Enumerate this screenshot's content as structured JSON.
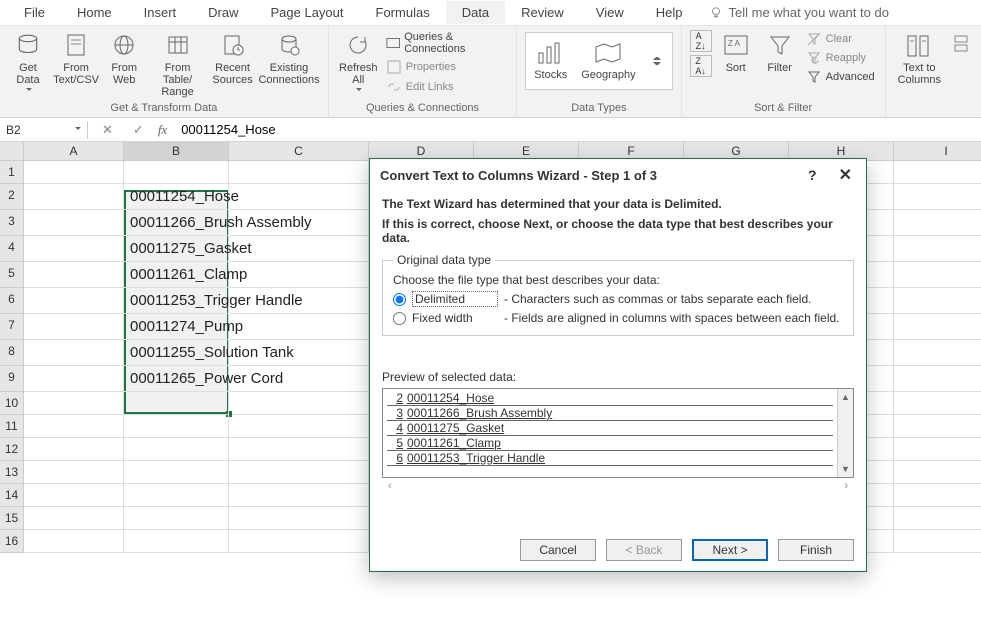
{
  "tabs": [
    "File",
    "Home",
    "Insert",
    "Draw",
    "Page Layout",
    "Formulas",
    "Data",
    "Review",
    "View",
    "Help"
  ],
  "active_tab": "Data",
  "tell_me": "Tell me what you want to do",
  "ribbon": {
    "groups": {
      "get_transform": {
        "label": "Get & Transform Data",
        "get_data": "Get\nData",
        "from_textcsv": "From\nText/CSV",
        "from_web": "From\nWeb",
        "from_table": "From Table/\nRange",
        "recent": "Recent\nSources",
        "existing": "Existing\nConnections"
      },
      "queries": {
        "label": "Queries & Connections",
        "refresh": "Refresh\nAll",
        "qc": "Queries & Connections",
        "props": "Properties",
        "edit": "Edit Links"
      },
      "datatypes": {
        "label": "Data Types",
        "stocks": "Stocks",
        "geo": "Geography"
      },
      "sortfilter": {
        "label": "Sort & Filter",
        "sort": "Sort",
        "filter": "Filter",
        "clear": "Clear",
        "reapply": "Reapply",
        "advanced": "Advanced"
      },
      "datatools": {
        "text_to_columns": "Text to\nColumns"
      }
    }
  },
  "namebox": "B2",
  "formula": "00011254_Hose",
  "columns": [
    "A",
    "B",
    "C",
    "D",
    "E",
    "F",
    "G",
    "H",
    "I"
  ],
  "rows": [
    1,
    2,
    3,
    4,
    5,
    6,
    7,
    8,
    9,
    10,
    11,
    12,
    13,
    14,
    15,
    16
  ],
  "data_col_b": [
    "",
    "00011254_Hose",
    "00011266_Brush Assembly",
    "00011275_Gasket",
    "00011261_Clamp",
    "00011253_Trigger Handle",
    "00011274_Pump",
    "00011255_Solution Tank",
    "00011265_Power Cord",
    "",
    "",
    "",
    "",
    "",
    "",
    ""
  ],
  "chart_data": {
    "type": "table",
    "title": "Column B raw values before Text-to-Columns split",
    "categories": [
      "Row 2",
      "Row 3",
      "Row 4",
      "Row 5",
      "Row 6",
      "Row 7",
      "Row 8",
      "Row 9"
    ],
    "values": [
      "00011254_Hose",
      "00011266_Brush Assembly",
      "00011275_Gasket",
      "00011261_Clamp",
      "00011253_Trigger Handle",
      "00011274_Pump",
      "00011255_Solution Tank",
      "00011265_Power Cord"
    ]
  },
  "dialog": {
    "title": "Convert Text to Columns Wizard - Step 1 of 3",
    "line1": "The Text Wizard has determined that your data is Delimited.",
    "line2": "If this is correct, choose Next, or choose the data type that best describes your data.",
    "legend": "Original data type",
    "choose": "Choose the file type that best describes your data:",
    "opt1": "Delimited",
    "opt1_desc": "- Characters such as commas or tabs separate each field.",
    "opt2": "Fixed width",
    "opt2_desc": "- Fields are aligned in columns with spaces between each field.",
    "preview_label": "Preview of selected data:",
    "preview": [
      {
        "n": "2",
        "t": "00011254_Hose"
      },
      {
        "n": "3",
        "t": "00011266_Brush Assembly"
      },
      {
        "n": "4",
        "t": "00011275_Gasket"
      },
      {
        "n": "5",
        "t": "00011261_Clamp"
      },
      {
        "n": "6",
        "t": "00011253_Trigger Handle"
      }
    ],
    "buttons": {
      "cancel": "Cancel",
      "back": "< Back",
      "next": "Next >",
      "finish": "Finish"
    }
  }
}
